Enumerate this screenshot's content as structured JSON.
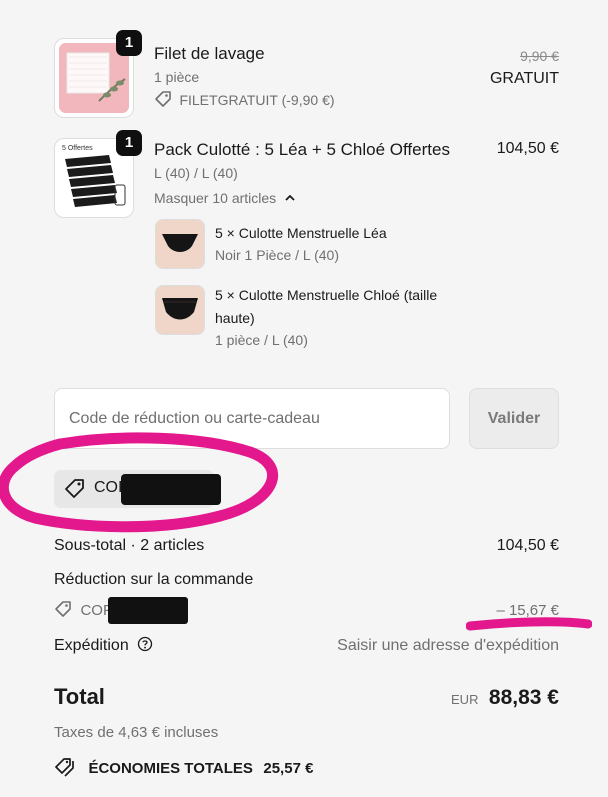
{
  "items": [
    {
      "quantity": "1",
      "title": "Filet de lavage",
      "subtitle": "1 pièce",
      "discount_label": "FILETGRATUIT (-9,90 €)",
      "original_price": "9,90 €",
      "price": "GRATUIT"
    },
    {
      "quantity": "1",
      "title": "Pack Culotté : 5 Léa + 5 Chloé Offertes",
      "subtitle": "L (40) / L (40)",
      "toggle_label": "Masquer 10 articles",
      "price": "104,50 €",
      "thumb_caption": "5 Offertes",
      "bundle": [
        {
          "title": "5 × Culotte Menstruelle Léa",
          "variant": "Noir 1 Pièce / L (40)"
        },
        {
          "title_line1": "5 × Culotte Menstruelle Chloé (taille",
          "title_line2": "haute)",
          "variant": "1 pièce / L (40)"
        }
      ]
    }
  ],
  "discount_input": {
    "placeholder": "Code de réduction ou carte-cadeau",
    "value": ""
  },
  "validate_label": "Valider",
  "applied_code_prefix": "COI",
  "summary": {
    "subtotal_label": "Sous-total · 2 articles",
    "subtotal_value": "104,50 €",
    "order_discount_label": "Réduction sur la commande",
    "order_discount_code_prefix": "COF",
    "order_discount_value": "– 15,67 €",
    "shipping_label": "Expédition",
    "shipping_value": "Saisir une adresse d'expédition"
  },
  "total": {
    "label": "Total",
    "currency": "EUR",
    "value": "88,83 €",
    "taxes": "Taxes de 4,63 € incluses"
  },
  "savings": {
    "label": "ÉCONOMIES TOTALES",
    "value": "25,57 €"
  },
  "colors": {
    "annotation_magenta": "#e3188d",
    "redaction": "#111111",
    "background": "#f5f5f5"
  },
  "icons": [
    "tag-icon",
    "chevron-up-icon",
    "help-circle-icon",
    "savings-tags-icon"
  ]
}
